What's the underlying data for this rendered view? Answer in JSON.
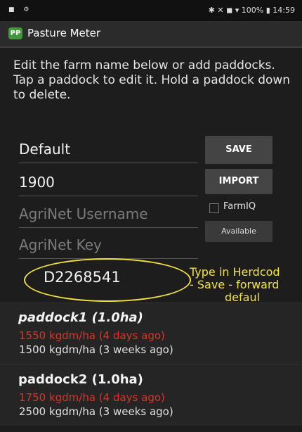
{
  "status": {
    "left_icons": "■ ⚙",
    "right_text": "✱ ✕ ◼ ▾ 100% ▮ 14:59"
  },
  "app": {
    "logo": "PP",
    "title": "Pasture Meter"
  },
  "intro": "Edit the farm name below or add paddocks. Tap a paddock to edit it. Hold a paddock down to delete.",
  "form": {
    "farm_name": "Default",
    "number": "1900",
    "agrinet_username_placeholder": "AgriNet Username",
    "agrinet_key_placeholder": "AgriNet Key",
    "herdcode": "D2268541"
  },
  "buttons": {
    "save": "SAVE",
    "import": "IMPORT",
    "farmiq": "FarmIQ",
    "available": "Available"
  },
  "annotation": {
    "line1": "Type in Herdcod",
    "line2": "- Save - forward",
    "line3": "defaul",
    "color": "#f2e33b"
  },
  "paddocks": [
    {
      "title": "paddock1 (1.0ha)",
      "recent": "1550 kgdm/ha (4 days ago)",
      "older": "1500 kgdm/ha (3 weeks ago)"
    },
    {
      "title": "paddock2 (1.0ha)",
      "recent": "1750 kgdm/ha (4 days ago)",
      "older": "2500 kgdm/ha (3 weeks ago)"
    }
  ],
  "colors": {
    "accent_green": "#3f9a3a",
    "recent_red": "#d9342b"
  }
}
